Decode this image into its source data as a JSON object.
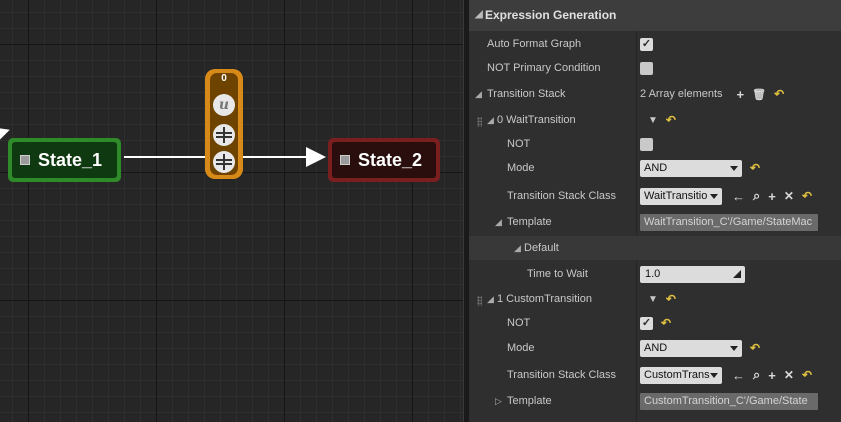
{
  "graph": {
    "state_1": "State_1",
    "state_2": "State_2",
    "transition_count": "0",
    "transition_logo": "u"
  },
  "details": {
    "category_title": "Expression Generation",
    "rows": {
      "auto_format": {
        "label": "Auto Format Graph",
        "checked": true
      },
      "not_primary": {
        "label": "NOT Primary Condition",
        "checked": false
      },
      "transition_stack": {
        "label": "Transition Stack",
        "value": "2 Array elements"
      },
      "el0": {
        "label": "0 WaitTransition"
      },
      "el0_not": {
        "label": "NOT",
        "checked": false
      },
      "el0_mode": {
        "label": "Mode",
        "value": "AND"
      },
      "el0_class": {
        "label": "Transition Stack Class",
        "value": "WaitTransitio"
      },
      "el0_template": {
        "label": "Template",
        "value": "WaitTransition_C'/Game/StateMac"
      },
      "el0_default": {
        "label": "Default"
      },
      "el0_time": {
        "label": "Time to Wait",
        "value": "1.0"
      },
      "el1": {
        "label": "1 CustomTransition"
      },
      "el1_not": {
        "label": "NOT",
        "checked": true
      },
      "el1_mode": {
        "label": "Mode",
        "value": "AND"
      },
      "el1_class": {
        "label": "Transition Stack Class",
        "value": "CustomTrans"
      },
      "el1_template": {
        "label": "Template",
        "value": "CustomTransition_C'/Game/State"
      }
    },
    "icons": {
      "add": "+",
      "delete": "🗑",
      "reset": "↶",
      "dropdown": "▼",
      "browse": "⌕",
      "use": "←",
      "clear": "✕",
      "check": "✓"
    }
  }
}
